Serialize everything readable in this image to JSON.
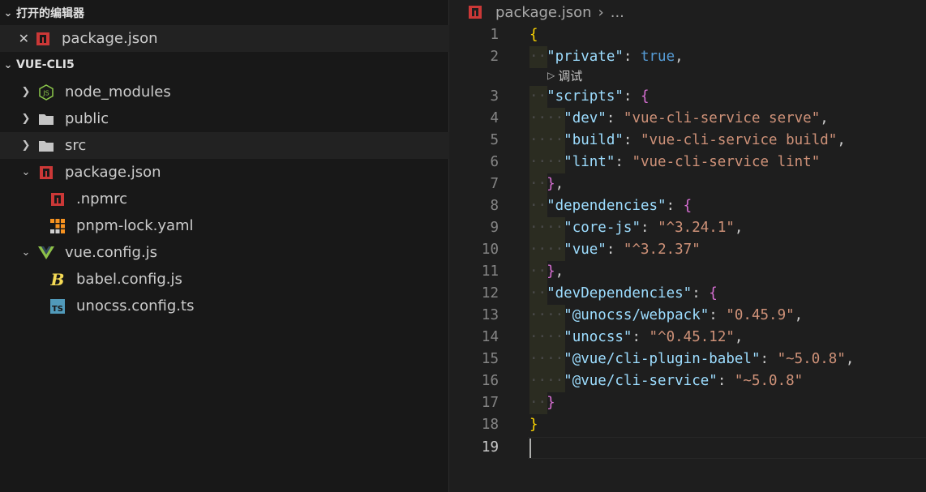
{
  "sidebar": {
    "open_editors": {
      "title": "打开的编辑器",
      "file": "package.json"
    },
    "project": {
      "title": "VUE-CLI5"
    },
    "tree": [
      {
        "label": "node_modules",
        "icon": "nodejs-icon",
        "arrow": "›",
        "indent": 0
      },
      {
        "label": "public",
        "icon": "folder-icon",
        "arrow": "›",
        "indent": 0
      },
      {
        "label": "src",
        "icon": "folder-icon",
        "arrow": "›",
        "indent": 0
      },
      {
        "label": "package.json",
        "icon": "npm-icon",
        "arrow": "⌄",
        "indent": 0
      },
      {
        "label": ".npmrc",
        "icon": "npm-icon",
        "arrow": "",
        "indent": 1
      },
      {
        "label": "pnpm-lock.yaml",
        "icon": "pnpm-icon",
        "arrow": "",
        "indent": 1
      },
      {
        "label": "vue.config.js",
        "icon": "vue-icon",
        "arrow": "⌄",
        "indent": 0
      },
      {
        "label": "babel.config.js",
        "icon": "babel-icon",
        "arrow": "",
        "indent": 1
      },
      {
        "label": "unocss.config.ts",
        "icon": "typescript-icon",
        "arrow": "",
        "indent": 1
      }
    ]
  },
  "editor": {
    "breadcrumb": {
      "file": "package.json",
      "sep": "›",
      "more": "..."
    },
    "codelens": "调试",
    "line_numbers": [
      "1",
      "2",
      "3",
      "4",
      "5",
      "6",
      "7",
      "8",
      "9",
      "10",
      "11",
      "12",
      "13",
      "14",
      "15",
      "16",
      "17",
      "18",
      "19"
    ]
  },
  "colors": {
    "string": "#ce9178",
    "key": "#9cdcfe",
    "bool": "#569cd6",
    "bracket": "#ffd700"
  }
}
